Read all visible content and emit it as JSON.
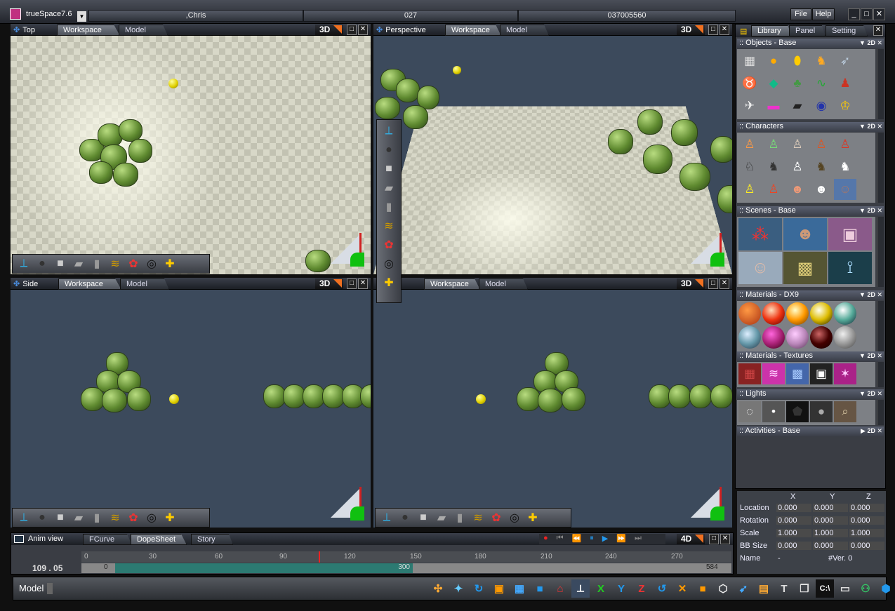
{
  "titlebar": {
    "app": "trueSpace7.6",
    "segments": [
      ",Chris",
      "027",
      "037005560"
    ],
    "file_label": "File",
    "help_label": "Help"
  },
  "viewports": {
    "top": {
      "title": "Top",
      "tab_workspace": "Workspace",
      "tab_model": "Model",
      "mode": "3D"
    },
    "perspective": {
      "title": "Perspective",
      "tab_workspace": "Workspace",
      "tab_model": "Model",
      "mode": "3D"
    },
    "side": {
      "title": "Side",
      "tab_workspace": "Workspace",
      "tab_model": "Model",
      "mode": "3D"
    },
    "front": {
      "title": "",
      "tab_workspace": "Workspace",
      "tab_model": "Model",
      "mode": "3D"
    }
  },
  "library": {
    "tabs": [
      "Library",
      "Panel",
      "Setting"
    ],
    "sections": [
      {
        "title": ":: Objects - Base",
        "mode": "2D"
      },
      {
        "title": ":: Characters",
        "mode": "2D"
      },
      {
        "title": ":: Scenes - Base",
        "mode": "2D"
      },
      {
        "title": ":: Materials - DX9",
        "mode": "2D"
      },
      {
        "title": ":: Materials - Textures",
        "mode": "2D"
      },
      {
        "title": ":: Lights",
        "mode": "2D"
      },
      {
        "title": ":: Activities - Base",
        "mode": "2D"
      }
    ]
  },
  "properties": {
    "cols": [
      "X",
      "Y",
      "Z"
    ],
    "rows": [
      {
        "label": "Location",
        "x": "0.000",
        "y": "0.000",
        "z": "0.000"
      },
      {
        "label": "Rotation",
        "x": "0.000",
        "y": "0.000",
        "z": "0.000"
      },
      {
        "label": "Scale",
        "x": "1.000",
        "y": "1.000",
        "z": "1.000"
      },
      {
        "label": "BB Size",
        "x": "0.000",
        "y": "0.000",
        "z": "0.000"
      }
    ],
    "name_label": "Name",
    "name_value": "-",
    "ver": "#Ver. 0"
  },
  "anim": {
    "title": "Anim view",
    "tabs": [
      "FCurve",
      "DopeSheet",
      "Story"
    ],
    "mode": "4D",
    "frame": "109 . 05",
    "ruler": [
      "0",
      "30",
      "60",
      "90",
      "120",
      "150",
      "180",
      "210",
      "240",
      "270"
    ],
    "range_start": "0",
    "range_mid": "300",
    "range_end": "584"
  },
  "status": {
    "mode_label": "Model"
  },
  "colors": {
    "accent": "#f07020",
    "viewport_bg": "#3c4a5c",
    "timeline_fill": "#2c7a72"
  }
}
